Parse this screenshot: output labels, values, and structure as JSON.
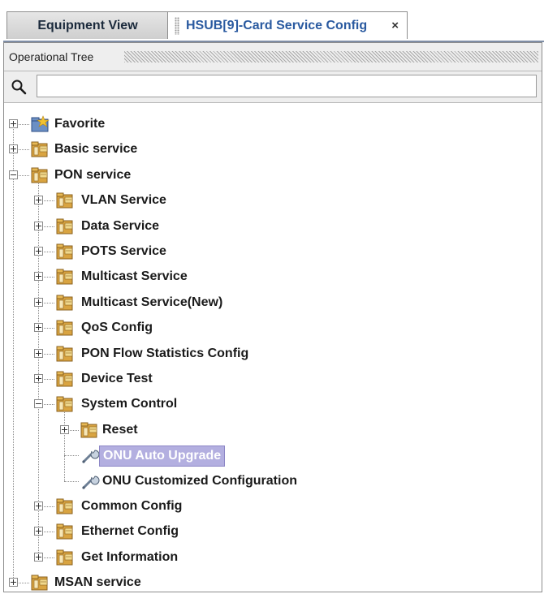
{
  "tabs": [
    {
      "label": "Equipment View",
      "active": false
    },
    {
      "label": "HSUB[9]-Card Service Config",
      "active": true,
      "close": "×"
    }
  ],
  "panel": {
    "title": "Operational Tree",
    "search": {
      "placeholder": "",
      "value": ""
    }
  },
  "tree": {
    "nodes": [
      {
        "label": "Favorite",
        "level": 0,
        "expanded": false,
        "icon": "favorite-folder-icon"
      },
      {
        "label": "Basic service",
        "level": 0,
        "expanded": false,
        "icon": "service-folder-icon"
      },
      {
        "label": "PON service",
        "level": 0,
        "expanded": true,
        "icon": "service-folder-icon"
      },
      {
        "label": "VLAN Service",
        "level": 1,
        "expanded": false,
        "icon": "service-folder-icon"
      },
      {
        "label": "Data Service",
        "level": 1,
        "expanded": false,
        "icon": "service-folder-icon"
      },
      {
        "label": "POTS Service",
        "level": 1,
        "expanded": false,
        "icon": "service-folder-icon"
      },
      {
        "label": "Multicast Service",
        "level": 1,
        "expanded": false,
        "icon": "service-folder-icon"
      },
      {
        "label": "Multicast Service(New)",
        "level": 1,
        "expanded": false,
        "icon": "service-folder-icon"
      },
      {
        "label": "QoS Config",
        "level": 1,
        "expanded": false,
        "icon": "service-folder-icon"
      },
      {
        "label": "PON Flow Statistics Config",
        "level": 1,
        "expanded": false,
        "icon": "service-folder-icon"
      },
      {
        "label": "Device Test",
        "level": 1,
        "expanded": false,
        "icon": "service-folder-icon"
      },
      {
        "label": "System Control",
        "level": 1,
        "expanded": true,
        "icon": "service-folder-icon"
      },
      {
        "label": "Reset",
        "level": 2,
        "expanded": false,
        "icon": "service-folder-icon"
      },
      {
        "label": "ONU Auto Upgrade",
        "level": 2,
        "leaf": true,
        "selected": true,
        "icon": "wrench-icon"
      },
      {
        "label": "ONU Customized Configuration",
        "level": 2,
        "leaf": true,
        "icon": "wrench-icon"
      },
      {
        "label": "Common Config",
        "level": 1,
        "expanded": false,
        "icon": "service-folder-icon"
      },
      {
        "label": "Ethernet Config",
        "level": 1,
        "expanded": false,
        "icon": "service-folder-icon"
      },
      {
        "label": "Get Information",
        "level": 1,
        "expanded": false,
        "icon": "service-folder-icon"
      },
      {
        "label": "MSAN service",
        "level": 0,
        "expanded": false,
        "icon": "service-folder-icon"
      }
    ]
  },
  "colors": {
    "active_tab_text": "#2a5aa0",
    "selection_bg": "#b3afe0",
    "folder": "#d9a441"
  }
}
